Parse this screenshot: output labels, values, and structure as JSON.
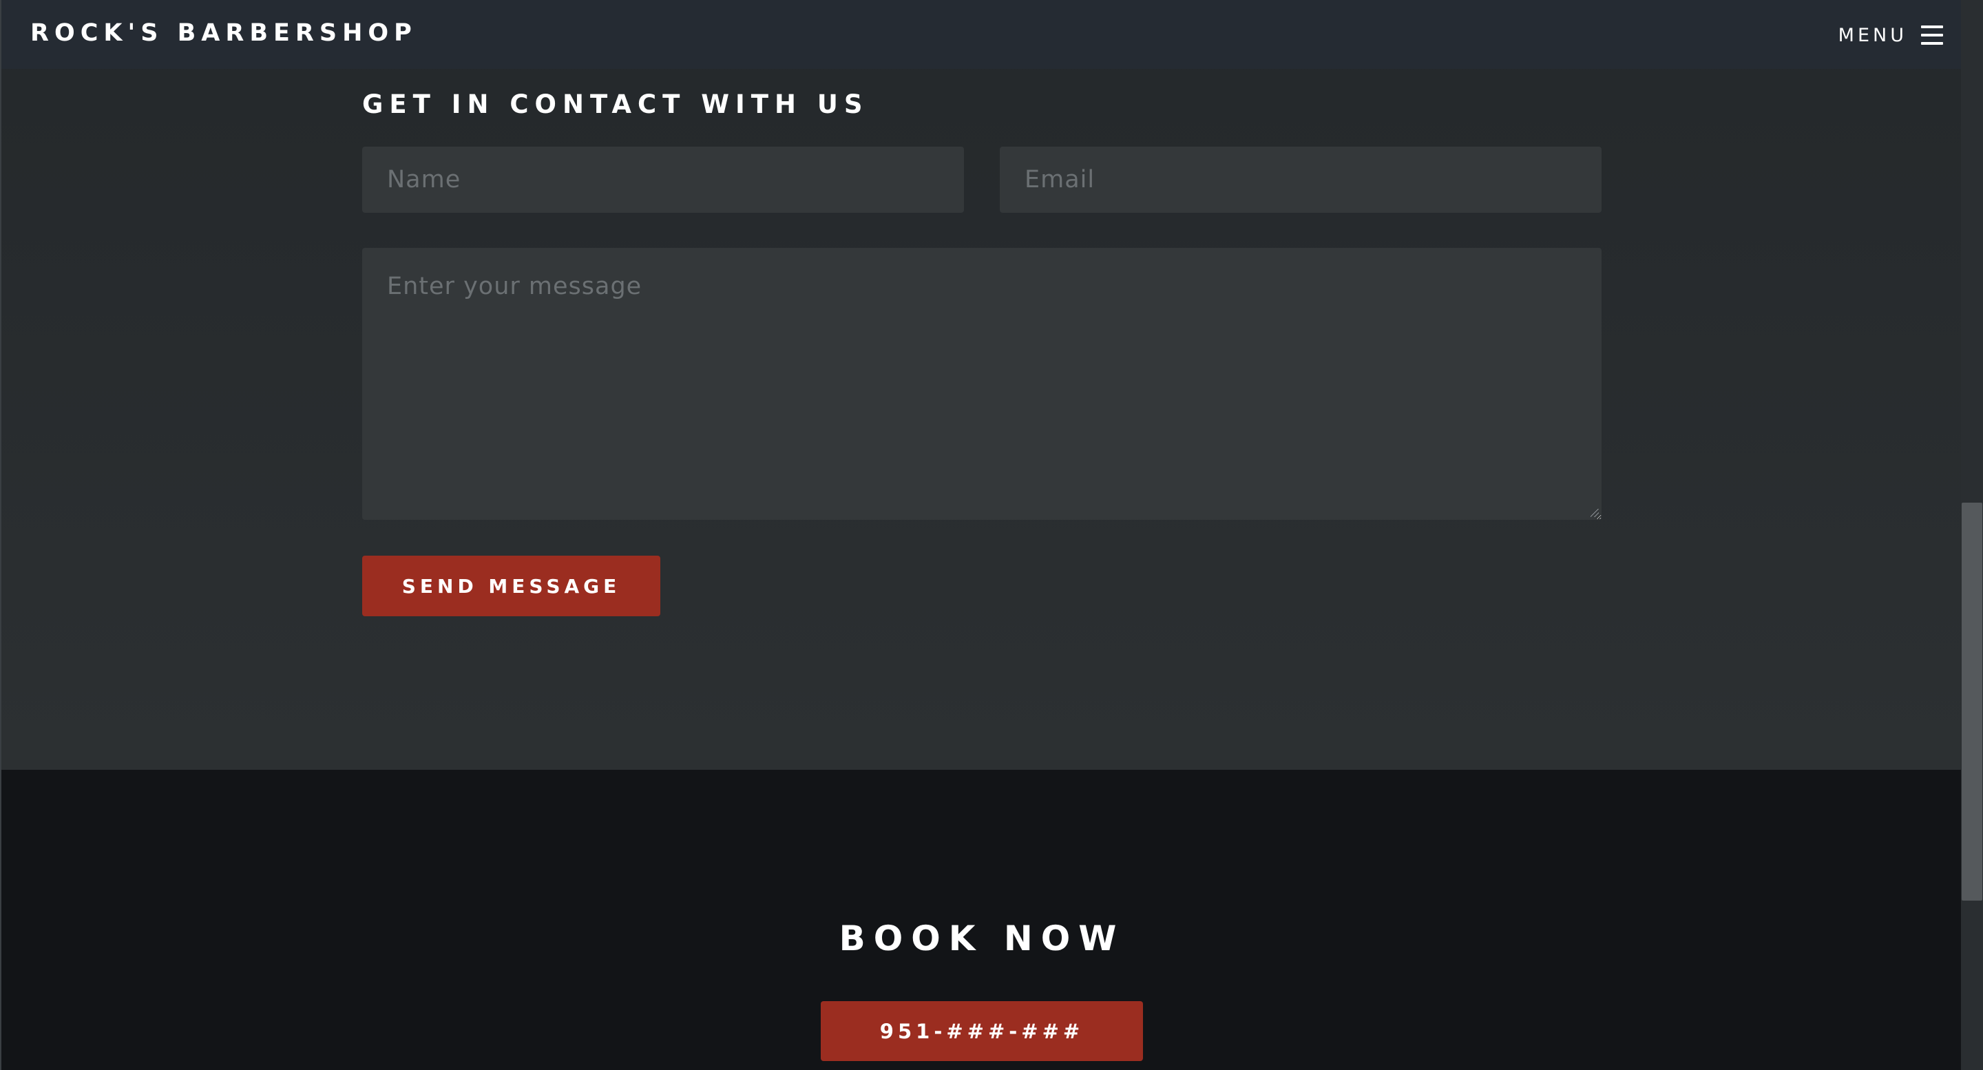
{
  "navbar": {
    "brand": "ROCK'S BARBERSHOP",
    "menu_label": "MENU",
    "menu_icon": "hamburger-icon"
  },
  "contact": {
    "heading": "GET IN CONTACT WITH US",
    "name_placeholder": "Name",
    "email_placeholder": "Email",
    "message_placeholder": "Enter your message",
    "send_label": "SEND MESSAGE"
  },
  "booking": {
    "heading": "BOOK NOW",
    "phone_label": "951-###-###"
  },
  "colors": {
    "accent_red": "#9b2d20",
    "navbar_bg": "#252b33",
    "footer_bg": "#121417",
    "field_bg": "#34383a"
  }
}
